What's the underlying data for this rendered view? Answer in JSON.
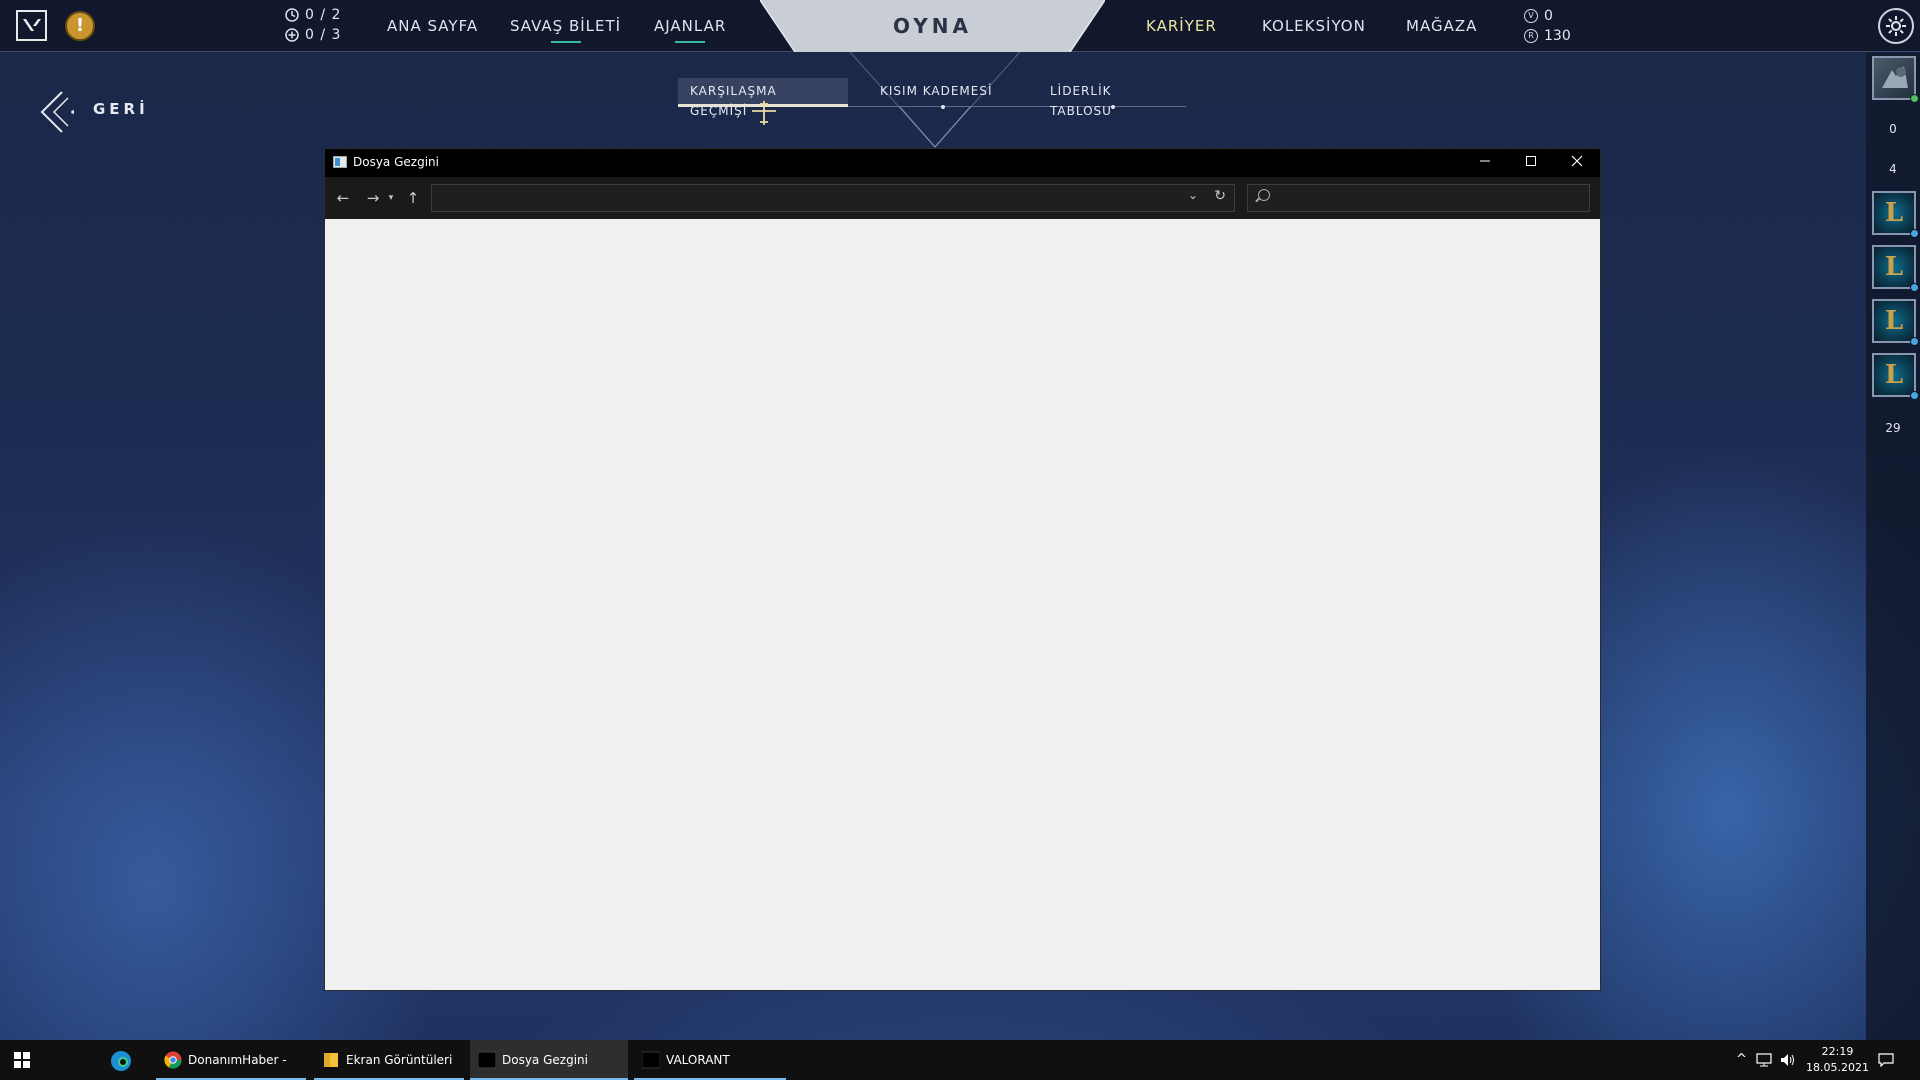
{
  "topbar": {
    "mission_daily": "0 / 2",
    "mission_weekly": "0 / 3",
    "nav_left": [
      "ANA SAYFA",
      "SAVAŞ BİLETİ",
      "AJANLAR"
    ],
    "play": "OYNA",
    "nav_right": [
      "KARİYER",
      "KOLEKSİYON",
      "MAĞAZA"
    ],
    "valorant_points": "0",
    "radianite_points": "130",
    "colors": {
      "active_nav": "#ede6a0",
      "accent": "#39b8a8"
    }
  },
  "back": {
    "label": "GERİ"
  },
  "subtabs": [
    "KARŞILAŞMA GEÇMİŞİ",
    "KISIM KADEMESİ",
    "LİDERLİK TABLOSU"
  ],
  "social": {
    "count_1": "0",
    "count_2": "4",
    "count_3": "29",
    "lol_glyph": "L"
  },
  "explorer": {
    "title": "Dosya Gezgini",
    "address_value": "",
    "search_placeholder": ""
  },
  "taskbar": {
    "items": [
      "DonanımHaber - C...",
      "Ekran Görüntüleri",
      "Dosya Gezgini",
      "VALORANT"
    ],
    "time": "22:19",
    "date": "18.05.2021"
  }
}
